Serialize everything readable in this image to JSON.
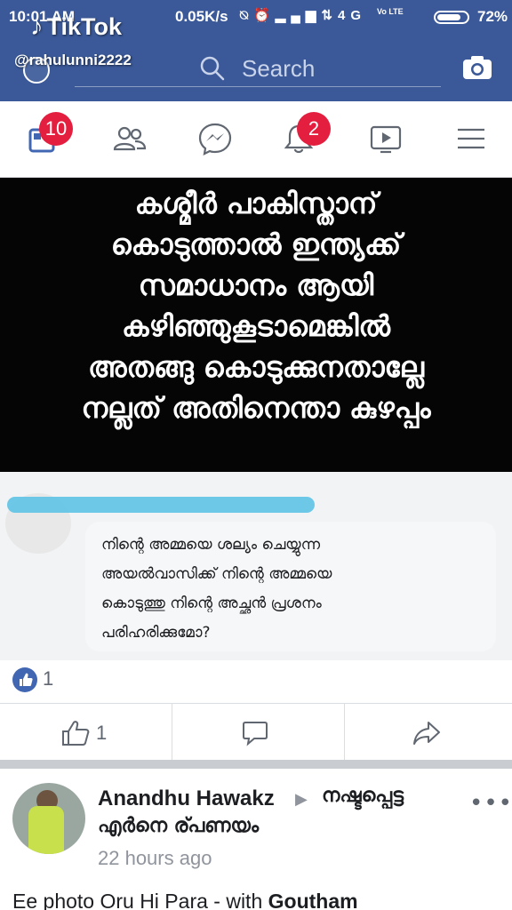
{
  "status_bar": {
    "time": "10:01 AM",
    "network_speed": "0.05K/s",
    "network_type": "4G",
    "volte": "Vo LTE",
    "battery": "72%"
  },
  "watermark": {
    "app": "TikTok",
    "handle": "@rahulunni2222"
  },
  "header": {
    "search_placeholder": "Search"
  },
  "nav": {
    "news_feed_badge": "10",
    "notifications_badge": "2"
  },
  "post_image": {
    "lines": [
      "കശ്മീർ പാകിസ്താന്",
      "കൊടുത്താൽ ഇന്ത്യക്ക്",
      "സമാധാനം ആയി",
      "കഴിഞ്ഞുകൂടാമെങ്കിൽ",
      "അതങ്ങു കൊടുക്കുനതാല്ലേ",
      "നല്ലത് അതിനെന്താ കുഴപ്പം"
    ]
  },
  "comment": {
    "lines": [
      "നിന്റെ അമ്മയെ ശല്യം ചെയ്യുന്ന",
      "അയൽവാസിക്ക് നിന്റെ അമ്മയെ",
      "കൊടുത്തു നിന്റെ അച്ഛൻ പ്രശനം",
      "പരിഹരിക്കുമോ?"
    ]
  },
  "reactions": {
    "count": "1"
  },
  "actions": {
    "like_count": "1"
  },
  "next_post": {
    "author": "Anandhu Hawakz",
    "target_line1": "നഷ്ടപ്പെട്ട",
    "target_line2": "എർനെ ര്പണയം",
    "time": "22 hours ago",
    "text_prefix": "Ee photo Oru Hi Para - with ",
    "text_tag": "Goutham"
  },
  "colors": {
    "brand": "#3b5998",
    "badge": "#e41e3f",
    "like": "#4267b2"
  }
}
